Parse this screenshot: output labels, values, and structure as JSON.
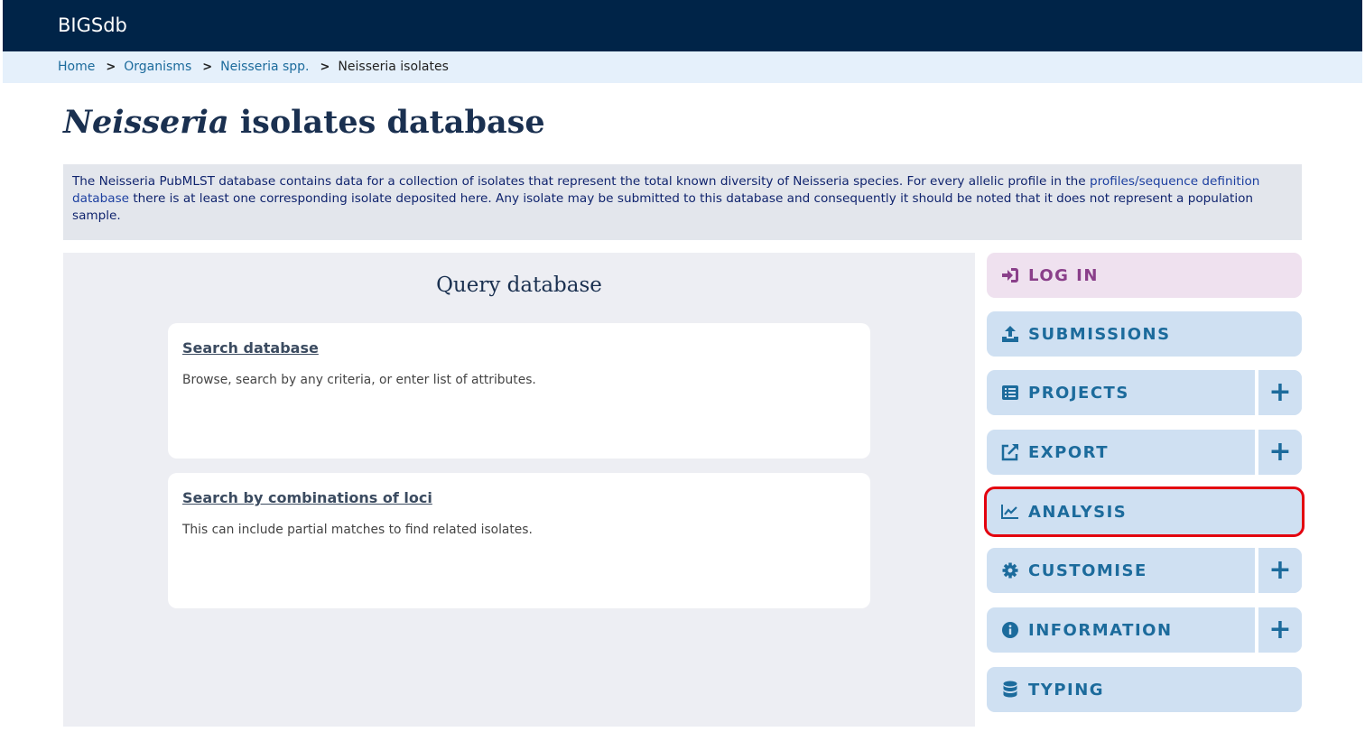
{
  "header": {
    "brand": "BIGSdb"
  },
  "breadcrumb": {
    "items": [
      {
        "label": "Home"
      },
      {
        "label": "Organisms"
      },
      {
        "label": "Neisseria spp."
      }
    ],
    "separator": ">",
    "current": "Neisseria isolates"
  },
  "page": {
    "title_italic": "Neisseria",
    "title_rest": " isolates database"
  },
  "intro": {
    "text_before": "The Neisseria PubMLST database contains data for a collection of isolates that represent the total known diversity of Neisseria species. For every allelic profile in the ",
    "link": "profiles/sequence definition database",
    "text_after": " there is at least one corresponding isolate deposited here. Any isolate may be submitted to this database and consequently it should be noted that it does not represent a population sample."
  },
  "query": {
    "heading": "Query database",
    "cards": [
      {
        "title": "Search database",
        "desc": "Browse, search by any criteria, or enter list of attributes."
      },
      {
        "title": "Search by combinations of loci",
        "desc": "This can include partial matches to find related isolates."
      }
    ]
  },
  "menu": {
    "items": [
      {
        "label": "LOG IN",
        "icon": "login-icon"
      },
      {
        "label": "SUBMISSIONS",
        "icon": "upload-icon"
      },
      {
        "label": "PROJECTS",
        "icon": "list-icon",
        "expand": "+"
      },
      {
        "label": "EXPORT",
        "icon": "external-link-icon",
        "expand": "+"
      },
      {
        "label": "ANALYSIS",
        "icon": "chart-line-icon"
      },
      {
        "label": "CUSTOMISE",
        "icon": "gear-icon",
        "expand": "+"
      },
      {
        "label": "INFORMATION",
        "icon": "info-icon",
        "expand": "+"
      },
      {
        "label": "TYPING",
        "icon": "database-icon"
      }
    ]
  },
  "colors": {
    "header_bg": "#002448",
    "breadcrumb_bg": "#e5f0fb",
    "menu_bg": "#cfe0f2",
    "menu_text": "#1c6b9c",
    "login_bg": "#efe1ef",
    "login_text": "#8a3f8a",
    "highlight": "#e3000f"
  }
}
